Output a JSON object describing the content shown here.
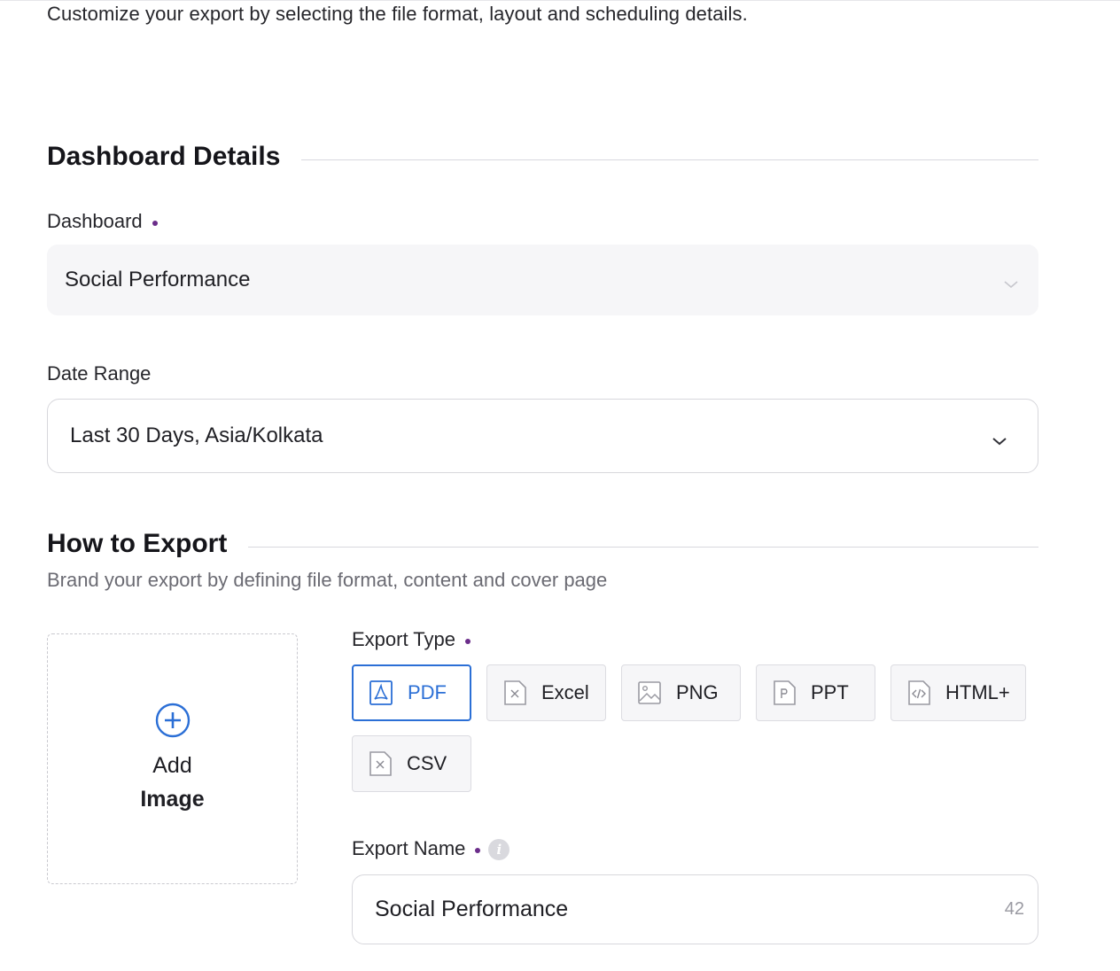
{
  "intro_text": "Customize your export by selecting the file format, layout and scheduling details.",
  "dashboard_details": {
    "heading": "Dashboard Details",
    "dashboard_label": "Dashboard",
    "dashboard_value": "Social Performance",
    "date_range_label": "Date Range",
    "date_range_value": "Last 30 Days, Asia/Kolkata"
  },
  "how_to_export": {
    "heading": "How to Export",
    "subtitle": "Brand your export by defining file format, content and cover page",
    "add_image": {
      "line1": "Add",
      "line2": "Image"
    },
    "export_type_label": "Export Type",
    "export_types": [
      {
        "label": "PDF",
        "icon": "pdf-file-icon",
        "selected": true
      },
      {
        "label": "Excel",
        "icon": "excel-file-icon",
        "selected": false
      },
      {
        "label": "PNG",
        "icon": "image-file-icon",
        "selected": false
      },
      {
        "label": "PPT",
        "icon": "ppt-file-icon",
        "selected": false
      },
      {
        "label": "HTML+",
        "icon": "html-file-icon",
        "selected": false
      },
      {
        "label": "CSV",
        "icon": "csv-file-icon",
        "selected": false
      }
    ],
    "export_name_label": "Export Name",
    "export_name_value": "Social Performance",
    "export_name_char_count": "42"
  },
  "colors": {
    "accent_blue": "#2b6fd6",
    "required_dot": "#6b2d8a",
    "filled_bg": "#f6f6f8"
  }
}
